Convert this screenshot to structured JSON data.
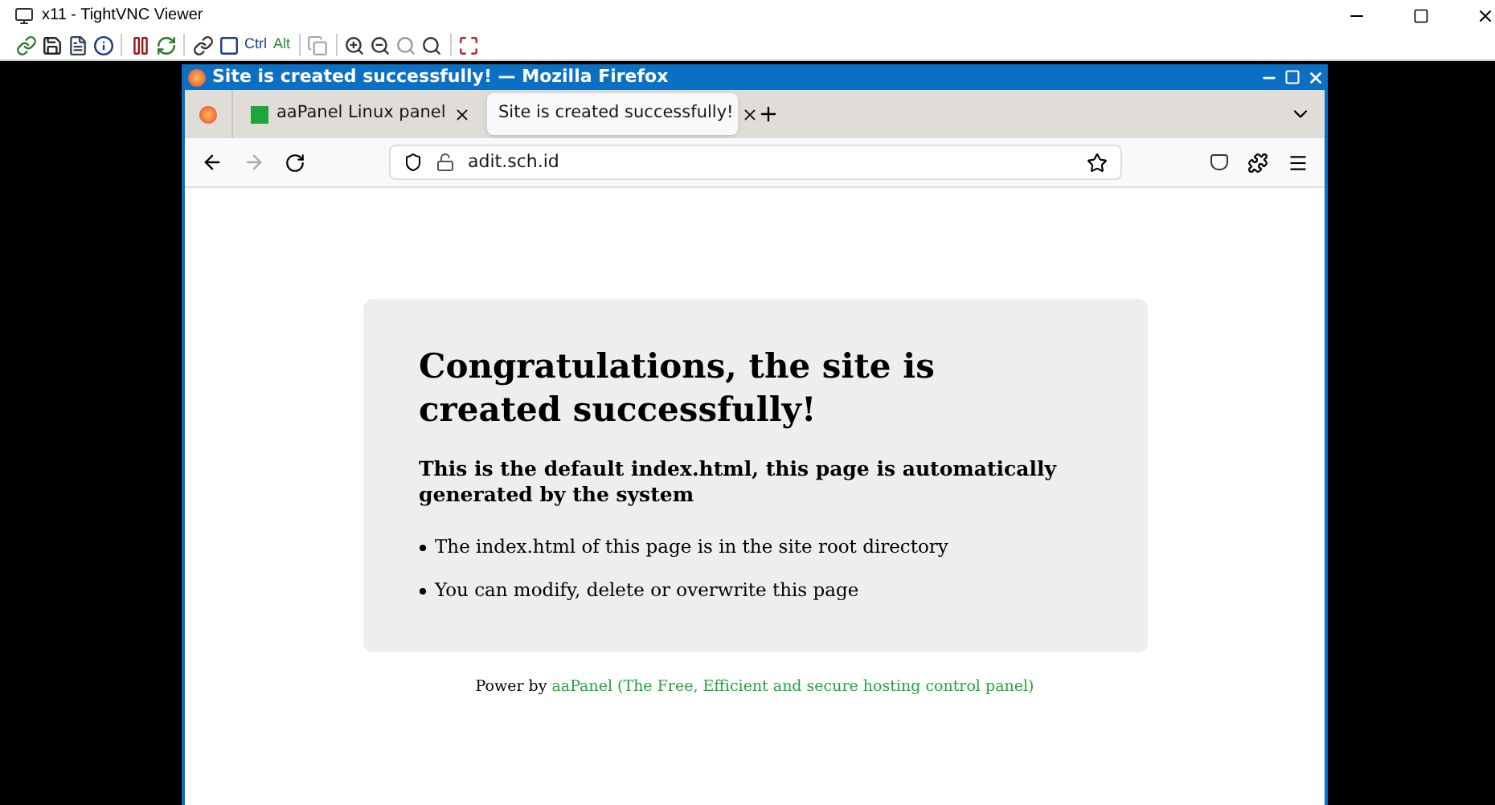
{
  "vnc": {
    "title": "x11 - TightVNC Viewer",
    "keys": [
      "Ctrl",
      "Alt"
    ]
  },
  "firefox": {
    "title": "Site is created successfully! — Mozilla Firefox",
    "tabs": [
      {
        "label": "aaPanel Linux panel",
        "selected": false
      },
      {
        "label": "Site is created successfully!",
        "selected": true
      }
    ],
    "url": "adit.sch.id"
  },
  "page": {
    "heading": "Congratulations, the site is created successfully!",
    "subheading": "This is the default index.html, this page is automatically generated by the system",
    "bullets": [
      "The index.html of this page is in the site root directory",
      "You can modify, delete or overwrite this page"
    ],
    "footer": {
      "prefix": "Power by",
      "link": "aaPanel (The Free, Efficient and secure hosting control panel)"
    }
  }
}
